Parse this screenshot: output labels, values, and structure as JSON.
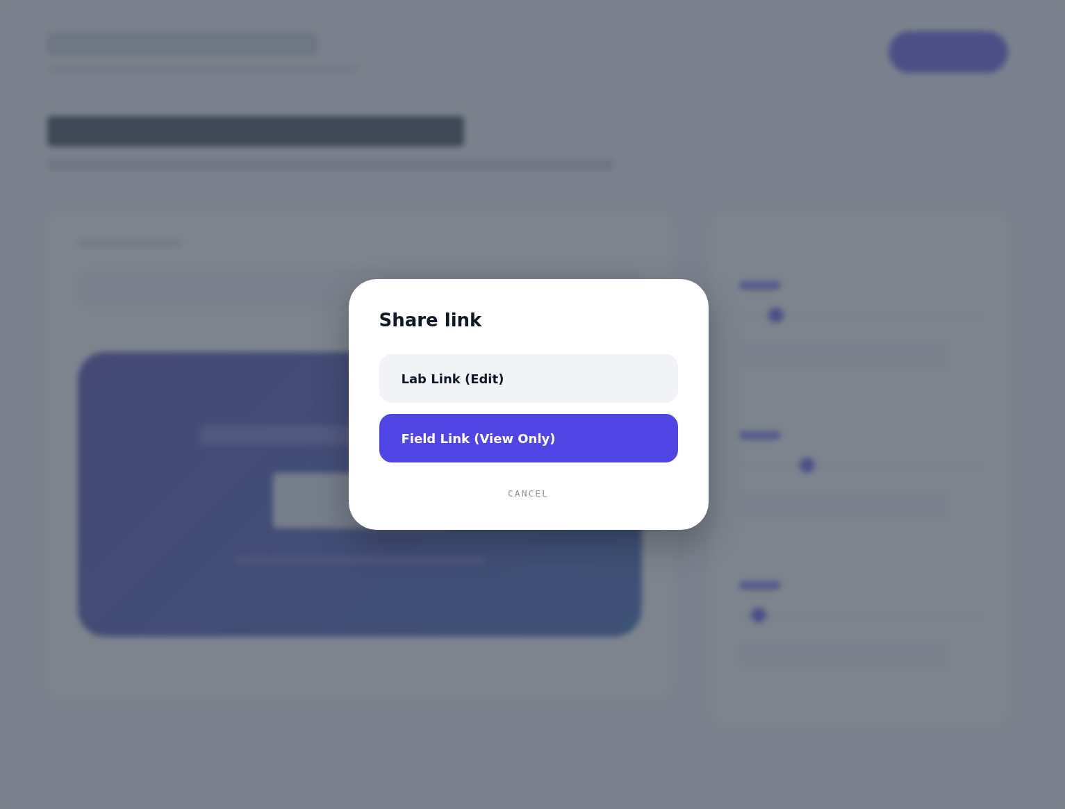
{
  "dialog": {
    "title": "Share link",
    "options": [
      {
        "label": "Lab Link (Edit)",
        "selected": false
      },
      {
        "label": "Field Link (View Only)",
        "selected": true
      }
    ],
    "cancel": "CANCEL"
  }
}
